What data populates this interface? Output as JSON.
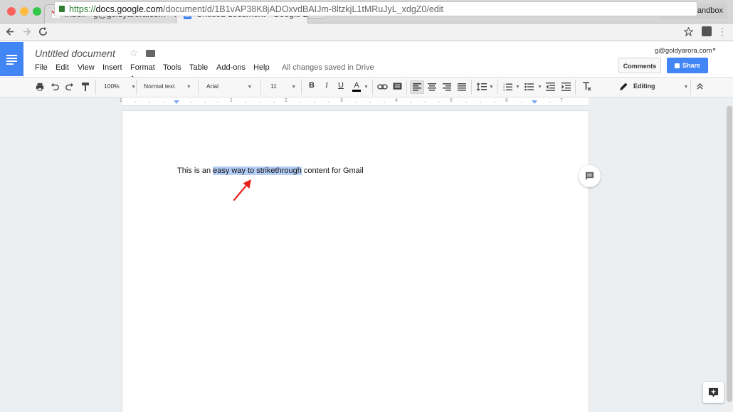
{
  "browser": {
    "tabs": [
      {
        "label": "Inbox - g@goldyarora.com - G"
      },
      {
        "label": "Untitled document - Google D"
      }
    ],
    "close_glyph": "×",
    "sandbox_label": "Goldy's Sandbox",
    "url": {
      "scheme": "https://",
      "host": "docs.google.com",
      "path": "/document/d/1B1vAP38K8jADOxvdBAIJm-8ltzkjL1tMRuJyL_xdgZ0/edit"
    },
    "nav_icons": [
      "back-arrow-icon",
      "forward-arrow-icon",
      "reload-icon"
    ],
    "traffic_colors": [
      "#fc605c",
      "#fdbc40",
      "#34c84a"
    ]
  },
  "docs": {
    "title": "Untitled document",
    "menu": [
      "File",
      "Edit",
      "View",
      "Insert",
      "Format",
      "Tools",
      "Table",
      "Add-ons",
      "Help"
    ],
    "save_status": "All changes saved in Drive",
    "account": "g@goldyarora.com",
    "comments_label": "Comments",
    "share_label": "Share",
    "accent": "#4285f4"
  },
  "toolbar": {
    "zoom": "100%",
    "style": "Normal text",
    "font": "Arial",
    "size": "11",
    "bold": "B",
    "italic": "I",
    "underline": "U",
    "text_color": "A",
    "mode": "Editing"
  },
  "ruler": {
    "ticks": [
      "1",
      "1",
      "2",
      "3",
      "4",
      "5",
      "6",
      "7"
    ]
  },
  "document": {
    "text_before": "This is an ",
    "text_selected": "easy way to strikethrough",
    "text_after": " content for Gmail",
    "highlight_color": "#b3cdf5",
    "annotation_color": "#e8231e"
  }
}
